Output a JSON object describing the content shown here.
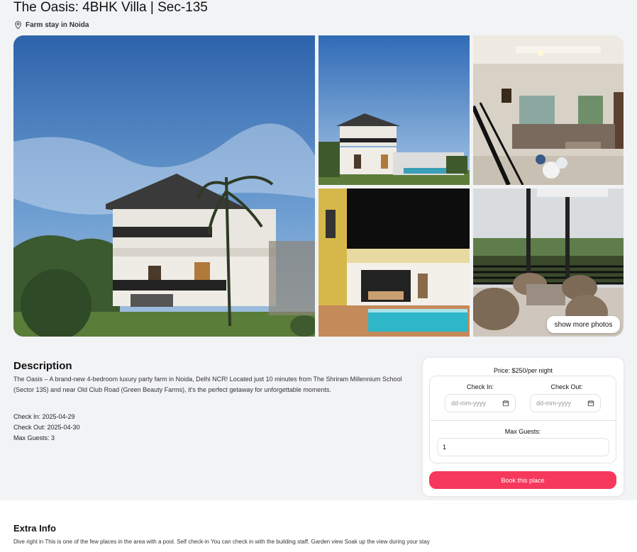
{
  "listing": {
    "title": "The Oasis: 4BHK Villa | Sec-135",
    "location": "Farm stay in Noida",
    "location_icon": "map-pin-icon"
  },
  "gallery": {
    "show_more_label": "show more photos"
  },
  "description": {
    "heading": "Description",
    "text": "The Oasis – A brand-new 4-bedroom luxury party farm in Noida, Delhi NCR! Located just 10 minutes from The Shriram Millennium School (Sector 135) and near Old Club Road (Green Beauty Farms), it's the perfect getaway for unforgettable moments.",
    "check_in": "Check In: 2025-04-29",
    "check_out": "Check Out: 2025-04-30",
    "max_guests": "Max Guests: 3"
  },
  "booking": {
    "price": "Price: $250/per night",
    "check_in_label": "Check In:",
    "check_out_label": "Check Out:",
    "date_placeholder": "dd-mm-yyyy",
    "calendar_icon": "calendar-icon",
    "guests_label": "Max Guests:",
    "guests_value": "1",
    "book_label": "Book this place",
    "accent": "#f5385c"
  },
  "extra": {
    "heading": "Extra Info",
    "text": "Dive right in This is one of the few places in the area with a pool. Self check-in You can check in with the building staff. Garden view Soak up the view during your stay"
  }
}
